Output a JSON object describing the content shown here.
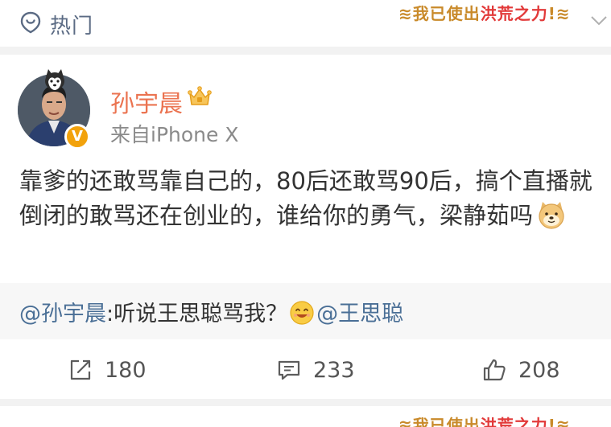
{
  "header": {
    "hot_label": "热门",
    "slogan_part1": "我已使出",
    "slogan_part2": "洪荒之力",
    "slogan_part3": "!"
  },
  "post": {
    "author": "孙宇晨",
    "source": "来自iPhone X",
    "text": "靠爹的还敢骂靠自己的，80后还敢骂90后，搞个直播就倒闭的敢骂还在创业的，谁给你的勇气，梁静茹吗",
    "verified_mark": "V",
    "quote": {
      "mention_author": "@孙宇晨",
      "text": ":听说王思聪骂我？",
      "mention_target": "@王思聪"
    },
    "actions": {
      "repost_count": "180",
      "comment_count": "233",
      "like_count": "208"
    }
  },
  "colors": {
    "author_name": "#eb7350",
    "link": "#4a6f96",
    "verified": "#f2a20c"
  },
  "icons": [
    "location-pin-icon",
    "crown-icon",
    "repost-icon",
    "comment-icon",
    "thumbs-up-icon",
    "chevron-down-icon"
  ]
}
